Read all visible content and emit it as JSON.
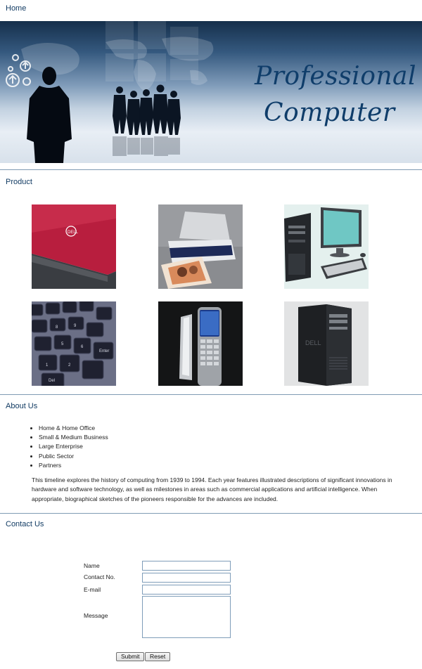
{
  "sections": {
    "home": "Home",
    "product": "Product",
    "about": "About Us",
    "contact": "Contact Us"
  },
  "banner": {
    "line1": "Professional",
    "line2": "Computer"
  },
  "products": [
    {
      "icon": "laptop-image"
    },
    {
      "icon": "printer-image"
    },
    {
      "icon": "desktop-computer-image"
    },
    {
      "icon": "keyboard-image"
    },
    {
      "icon": "mobile-phone-image"
    },
    {
      "icon": "workstation-tower-image"
    }
  ],
  "about": {
    "items": [
      "Home & Home Office",
      "Small & Medium Business",
      "Large Enterprise",
      "Public Sector",
      "Partners"
    ],
    "text": "This timeline explores the history of computing from 1939 to 1994. Each year features illustrated descriptions of significant innovations in hardware and software technology, as well as milestones in areas such as commercial applications and artificial intelligence. When appropriate, biographical sketches of the pioneers responsible for the advances are included."
  },
  "contact": {
    "name_label": "Name",
    "name_value": "",
    "phone_label": "Contact No.",
    "phone_value": "",
    "email_label": "E-mail",
    "email_value": "",
    "message_label": "Message",
    "message_value": "",
    "submit_label": "Submit",
    "reset_label": "Reset"
  },
  "colors": {
    "heading": "#123b63",
    "rule": "#7f9bb3",
    "banner_title": "#0f3d6a"
  }
}
